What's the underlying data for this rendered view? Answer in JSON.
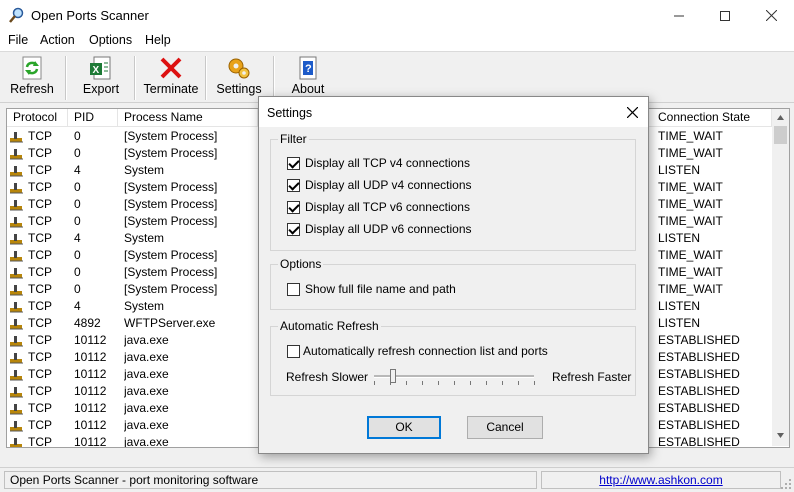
{
  "window": {
    "title": "Open Ports Scanner"
  },
  "menu": [
    "File",
    "Action",
    "Options",
    "Help"
  ],
  "toolbar": [
    {
      "label": "Refresh",
      "icon": "refresh-icon"
    },
    {
      "label": "Export",
      "icon": "excel-export-icon"
    },
    {
      "label": "Terminate",
      "icon": "red-x-icon"
    },
    {
      "label": "Settings",
      "icon": "gears-icon"
    },
    {
      "label": "About",
      "icon": "help-document-icon"
    }
  ],
  "table": {
    "columns": [
      "Protocol",
      "PID",
      "Process Name",
      "Connection State"
    ],
    "rows": [
      [
        "TCP",
        "0",
        "[System Process]",
        "TIME_WAIT"
      ],
      [
        "TCP",
        "0",
        "[System Process]",
        "TIME_WAIT"
      ],
      [
        "TCP",
        "4",
        "System",
        "LISTEN"
      ],
      [
        "TCP",
        "0",
        "[System Process]",
        "TIME_WAIT"
      ],
      [
        "TCP",
        "0",
        "[System Process]",
        "TIME_WAIT"
      ],
      [
        "TCP",
        "0",
        "[System Process]",
        "TIME_WAIT"
      ],
      [
        "TCP",
        "4",
        "System",
        "LISTEN"
      ],
      [
        "TCP",
        "0",
        "[System Process]",
        "TIME_WAIT"
      ],
      [
        "TCP",
        "0",
        "[System Process]",
        "TIME_WAIT"
      ],
      [
        "TCP",
        "0",
        "[System Process]",
        "TIME_WAIT"
      ],
      [
        "TCP",
        "4",
        "System",
        "LISTEN"
      ],
      [
        "TCP",
        "4892",
        "WFTPServer.exe",
        "LISTEN"
      ],
      [
        "TCP",
        "10112",
        "java.exe",
        "ESTABLISHED"
      ],
      [
        "TCP",
        "10112",
        "java.exe",
        "ESTABLISHED"
      ],
      [
        "TCP",
        "10112",
        "java.exe",
        "ESTABLISHED"
      ],
      [
        "TCP",
        "10112",
        "java.exe",
        "ESTABLISHED"
      ],
      [
        "TCP",
        "10112",
        "java.exe",
        "ESTABLISHED"
      ],
      [
        "TCP",
        "10112",
        "java.exe",
        "ESTABLISHED"
      ],
      [
        "TCP",
        "10112",
        "java.exe",
        "ESTABLISHED"
      ]
    ]
  },
  "status": {
    "text": "Open Ports Scanner - port monitoring software",
    "link": "http://www.ashkon.com"
  },
  "dialog": {
    "title": "Settings",
    "filter": {
      "title": "Filter",
      "options": [
        {
          "label": "Display all TCP v4 connections",
          "checked": true
        },
        {
          "label": "Display all UDP v4 connections",
          "checked": true
        },
        {
          "label": "Display all TCP v6 connections",
          "checked": true
        },
        {
          "label": "Display all UDP v6 connections",
          "checked": true
        }
      ]
    },
    "options": {
      "title": "Options",
      "show_full_path": {
        "label": "Show full file name and path",
        "checked": false
      }
    },
    "auto_refresh": {
      "title": "Automatic Refresh",
      "auto": {
        "label": "Automatically refresh connection list and ports",
        "checked": false
      },
      "slower_label": "Refresh Slower",
      "faster_label": "Refresh Faster",
      "slider_value": 0.1
    },
    "ok_label": "OK",
    "cancel_label": "Cancel"
  }
}
